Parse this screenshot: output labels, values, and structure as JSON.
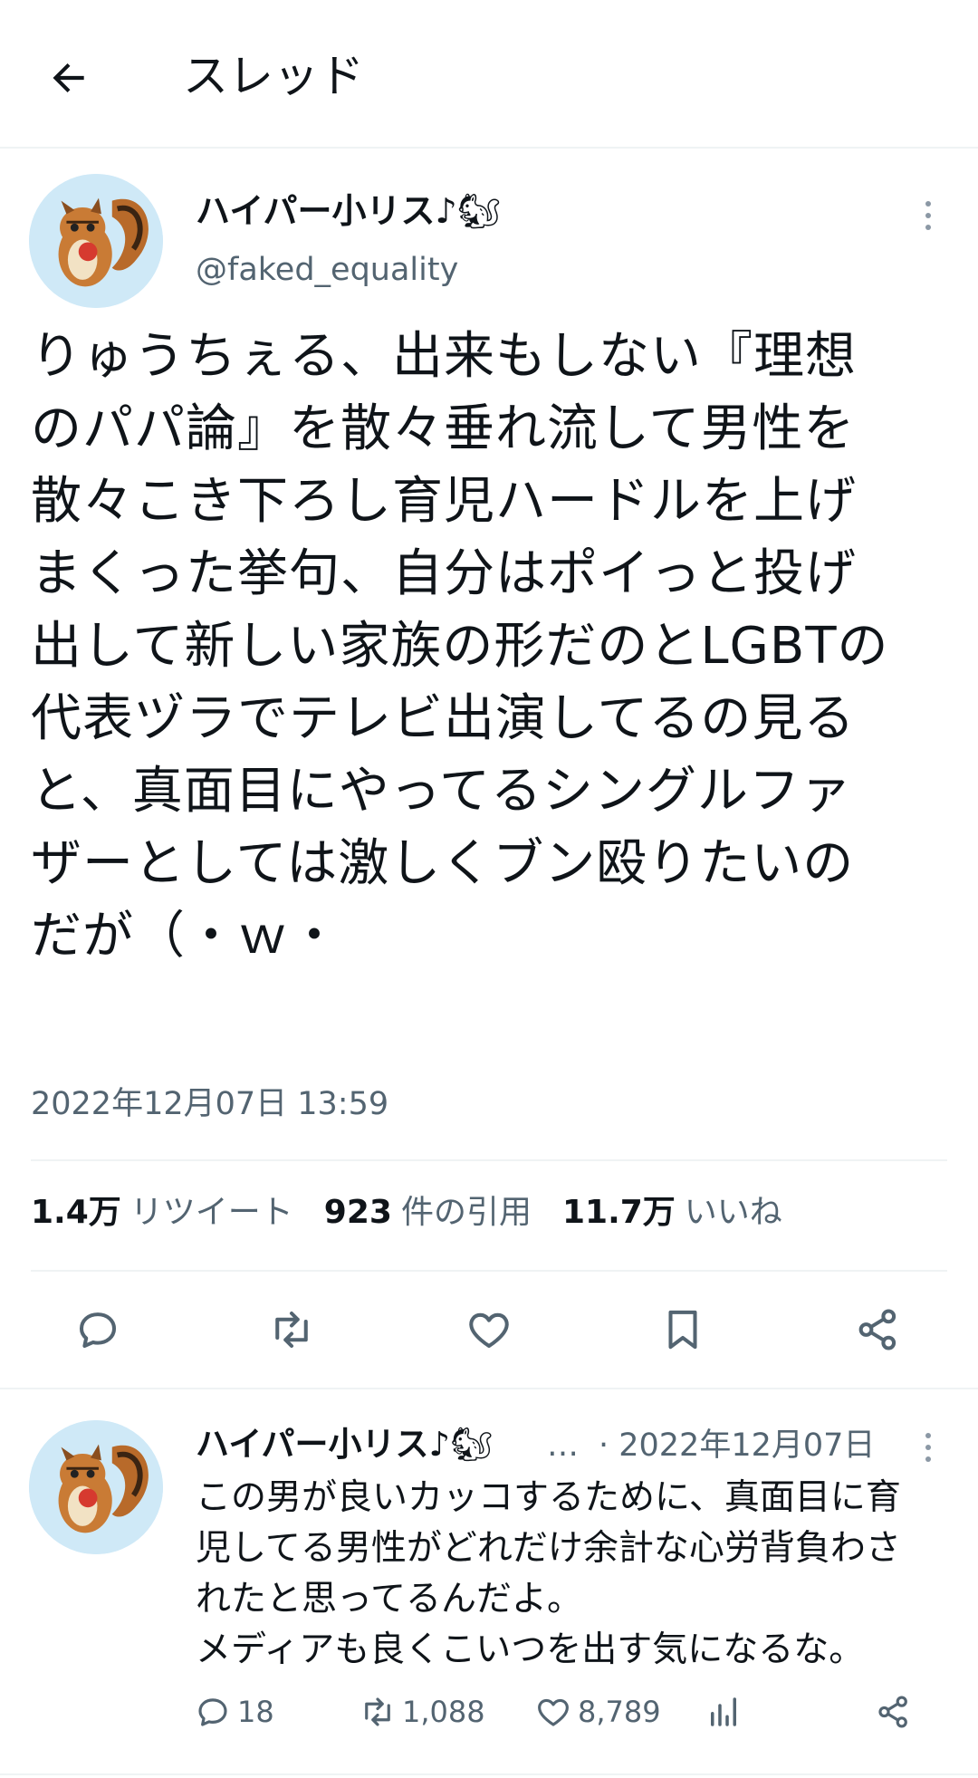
{
  "header": {
    "title": "スレッド"
  },
  "tweet": {
    "author_name": "ハイパー小リス♪",
    "author_emoji": "🐿",
    "handle": "@faked_equality",
    "text_lines": [
      "りゅうちぇる、出来もしない『理想",
      "のパパ論』を散々垂れ流して男性を",
      "散々こき下ろし育児ハードルを上げ",
      "まくった挙句、自分はポイっと投げ",
      "出して新しい家族の形だのとLGBTの",
      "代表ヅラでテレビ出演してるの見る",
      "と、真面目にやってるシングルファ",
      "ザーとしては激しくブン殴りたいの",
      "だが（・ｗ・"
    ],
    "timestamp": "2022年12月07日 13:59",
    "stats": {
      "retweets_value": "1.4万",
      "retweets_label": "リツイート",
      "quotes_value": "923",
      "quotes_label": "件の引用",
      "likes_value": "11.7万",
      "likes_label": "いいね"
    }
  },
  "reply": {
    "author_name": "ハイパー小リス♪",
    "author_emoji": "🐿",
    "ellipsis": "…",
    "meta": "· 2022年12月07日",
    "text_lines": [
      "この男が良いカッコするために、真面目に育",
      "児してる男性がどれだけ余計な心労背負わさ",
      "れたと思ってるんだよ。",
      "メディアも良くこいつを出す気になるな。"
    ],
    "replies_count": "18",
    "retweets_count": "1,088",
    "likes_count": "8,789"
  },
  "colors": {
    "text": "#0f1419",
    "secondary": "#536471",
    "divider": "#eff3f4",
    "avatar_bg": "#cfe9f7"
  },
  "icons": [
    "arrow-left-icon",
    "more-icon",
    "reply-icon",
    "retweet-icon",
    "like-icon",
    "bookmark-icon",
    "share-icon",
    "analytics-icon",
    "squirrel-emoji"
  ]
}
